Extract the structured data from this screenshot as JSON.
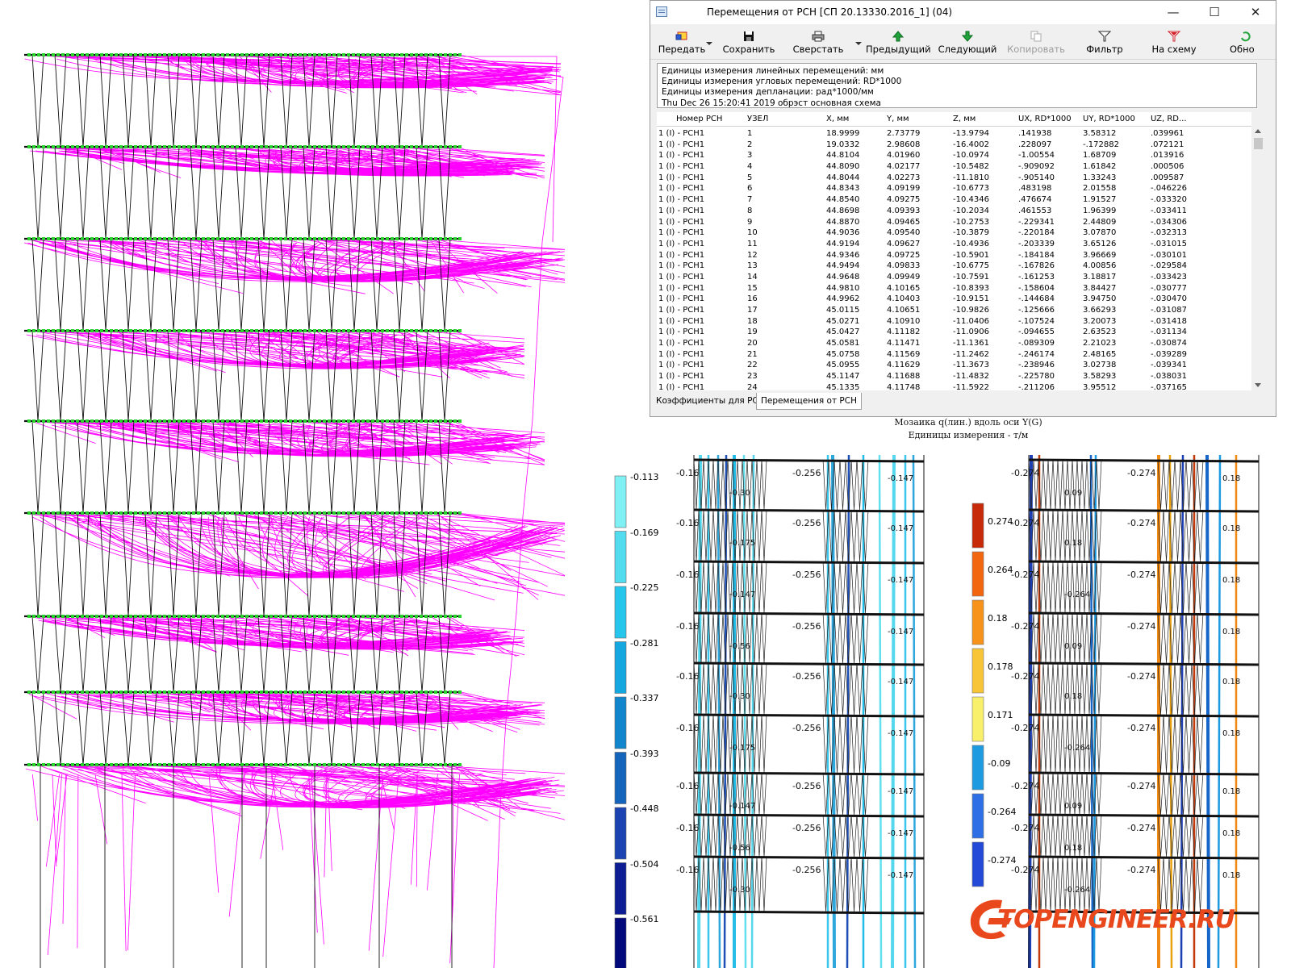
{
  "window": {
    "title": "Перемещения от РСН [СП 20.13330.2016_1] (04)",
    "minimize": "—",
    "maximize": "☐",
    "close": "✕"
  },
  "toolbar": {
    "send": "Передать",
    "save": "Сохранить",
    "layout": "Сверстать",
    "prev": "Предыдущий",
    "next": "Следующий",
    "copy": "Копировать",
    "filter": "Фильтр",
    "to_scheme": "На схему",
    "refresh": "Обно"
  },
  "info": {
    "line1": "Единицы измерения линейных перемещений: мм",
    "line2": "Единицы измерения угловых перемещений: RD*1000",
    "line3": "Единицы измерения депланации: рад*1000/мм",
    "line4": "Thu Dec 26 15:20:41 2019  обрэст  основная схема"
  },
  "table": {
    "headers": [
      "Номер РСН",
      "УЗЕЛ",
      "X, мм",
      "Y, мм",
      "Z, мм",
      "UX, RD*1000",
      "UY, RD*1000",
      "UZ, RD..."
    ],
    "rows": [
      [
        "1 (I) - РСН1",
        "1",
        "18.9999",
        "2.73779",
        "-13.9794",
        ".141938",
        "3.58312",
        ".039961"
      ],
      [
        "1 (I) - РСН1",
        "2",
        "19.0332",
        "2.98608",
        "-16.4002",
        ".228097",
        "-.172882",
        ".072121"
      ],
      [
        "1 (I) - РСН1",
        "3",
        "44.8104",
        "4.01960",
        "-10.0974",
        "-1.00554",
        "1.68709",
        ".013916"
      ],
      [
        "1 (I) - РСН1",
        "4",
        "44.8090",
        "4.02177",
        "-10.5482",
        "-.909092",
        "1.61842",
        ".000506"
      ],
      [
        "1 (I) - РСН1",
        "5",
        "44.8044",
        "4.02273",
        "-11.1810",
        "-.905140",
        "1.33243",
        ".009587"
      ],
      [
        "1 (I) - РСН1",
        "6",
        "44.8343",
        "4.09199",
        "-10.6773",
        ".483198",
        "2.01558",
        "-.046226"
      ],
      [
        "1 (I) - РСН1",
        "7",
        "44.8540",
        "4.09275",
        "-10.4346",
        ".476674",
        "1.91527",
        "-.033320"
      ],
      [
        "1 (I) - РСН1",
        "8",
        "44.8698",
        "4.09393",
        "-10.2034",
        ".461553",
        "1.96399",
        "-.033411"
      ],
      [
        "1 (I) - РСН1",
        "9",
        "44.8870",
        "4.09465",
        "-10.2753",
        "-.229341",
        "2.44809",
        "-.034306"
      ],
      [
        "1 (I) - РСН1",
        "10",
        "44.9036",
        "4.09540",
        "-10.3879",
        "-.220184",
        "3.07870",
        "-.032313"
      ],
      [
        "1 (I) - РСН1",
        "11",
        "44.9194",
        "4.09627",
        "-10.4936",
        "-.203339",
        "3.65126",
        "-.031015"
      ],
      [
        "1 (I) - РСН1",
        "12",
        "44.9346",
        "4.09725",
        "-10.5901",
        "-.184184",
        "3.96669",
        "-.030101"
      ],
      [
        "1 (I) - РСН1",
        "13",
        "44.9494",
        "4.09833",
        "-10.6775",
        "-.167826",
        "4.00856",
        "-.029584"
      ],
      [
        "1 (I) - РСН1",
        "14",
        "44.9648",
        "4.09949",
        "-10.7591",
        "-.161253",
        "3.18817",
        "-.033423"
      ],
      [
        "1 (I) - РСН1",
        "15",
        "44.9810",
        "4.10165",
        "-10.8393",
        "-.158604",
        "3.84427",
        "-.030777"
      ],
      [
        "1 (I) - РСН1",
        "16",
        "44.9962",
        "4.10403",
        "-10.9151",
        "-.144684",
        "3.94750",
        "-.030470"
      ],
      [
        "1 (I) - РСН1",
        "17",
        "45.0115",
        "4.10651",
        "-10.9826",
        "-.125666",
        "3.66293",
        "-.031087"
      ],
      [
        "1 (I) - РСН1",
        "18",
        "45.0271",
        "4.10910",
        "-11.0406",
        "-.107524",
        "3.20073",
        "-.031418"
      ],
      [
        "1 (I) - РСН1",
        "19",
        "45.0427",
        "4.11182",
        "-11.0906",
        "-.094655",
        "2.63523",
        "-.031134"
      ],
      [
        "1 (I) - РСН1",
        "20",
        "45.0581",
        "4.11471",
        "-11.1361",
        "-.089309",
        "2.21023",
        "-.030874"
      ],
      [
        "1 (I) - РСН1",
        "21",
        "45.0758",
        "4.11569",
        "-11.2462",
        "-.246174",
        "2.48165",
        "-.039289"
      ],
      [
        "1 (I) - РСН1",
        "22",
        "45.0955",
        "4.11629",
        "-11.3673",
        "-.238946",
        "3.02738",
        "-.039341"
      ],
      [
        "1 (I) - РСН1",
        "23",
        "45.1147",
        "4.11688",
        "-11.4832",
        "-.225780",
        "3.58293",
        "-.038031"
      ],
      [
        "1 (I) - РСН1",
        "24",
        "45.1335",
        "4.11748",
        "-11.5922",
        "-.211206",
        "3.95512",
        "-.037165"
      ]
    ]
  },
  "tabs": {
    "coefficients": "Коэффициенты для РСН",
    "displacements": "Перемещения от РСН"
  },
  "mosaic": {
    "title": "Мозаика q(лин.) вдоль оси  Y(G)",
    "units": "Единицы измерения - т/м",
    "legend_left": [
      "-0.113",
      "-0.169",
      "-0.225",
      "-0.281",
      "-0.337",
      "-0.393",
      "-0.448",
      "-0.504",
      "-0.561"
    ],
    "legend_left_colors": [
      "#7ff0f3",
      "#52dcef",
      "#26c6ec",
      "#14a7e0",
      "#1286cc",
      "#1665bd",
      "#1b44b2",
      "#0d1e94",
      "#03087a"
    ],
    "legend_right": [
      "0.274",
      "0.264",
      "0.18",
      "0.178",
      "0.171",
      "-0.09",
      "-0.264",
      "-0.274"
    ],
    "legend_right_colors": [
      "#c72a08",
      "#f1660f",
      "#f7921a",
      "#f8c438",
      "#f8ef6a",
      "#1e9ae0",
      "#2e6fe6",
      "#2448d8"
    ],
    "tags_left": [
      "-0.16",
      "-0.256",
      "-0.30",
      "-0.175",
      "-0.147",
      "-0.56"
    ],
    "tags_right": [
      "-0.274",
      "0.274",
      "0.09",
      "0.18",
      "-0.264"
    ]
  },
  "logo": {
    "text": "TOPENGINEER.RU"
  }
}
